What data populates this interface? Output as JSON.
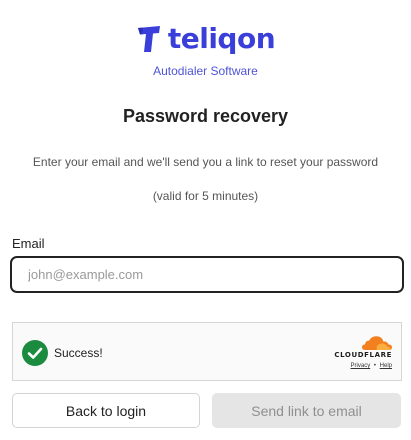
{
  "brand": {
    "name": "teliqon",
    "tagline": "Autodialer Software",
    "color": "#3a3fd9"
  },
  "page": {
    "title": "Password recovery",
    "description_line1": "Enter your email and we'll send you a link to reset your password",
    "description_line2": "(valid for 5 minutes)"
  },
  "form": {
    "email_label": "Email",
    "email_value": "",
    "email_placeholder": "john@example.com"
  },
  "captcha": {
    "status_text": "Success!",
    "status_icon": "checkmark-circle-icon",
    "status_color": "#1b8c3f",
    "provider": "CLOUDFLARE",
    "provider_color": "#f38020",
    "privacy_label": "Privacy",
    "separator": "•",
    "help_label": "Help"
  },
  "buttons": {
    "back_label": "Back to login",
    "send_label": "Send link to email"
  }
}
